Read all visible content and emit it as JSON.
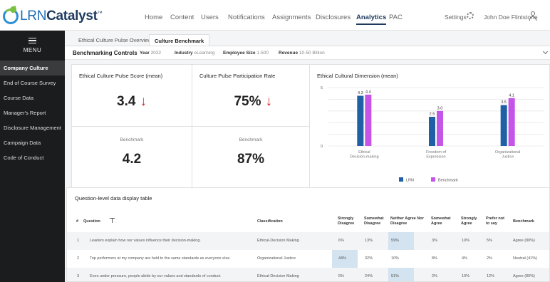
{
  "brand": {
    "prefix": "LRN",
    "suffix": "Catalyst",
    "tm": "™"
  },
  "topnav": {
    "items": [
      "Home",
      "Content",
      "Users",
      "Notifications",
      "Assignments",
      "Disclosures",
      "Analytics",
      "PAC"
    ],
    "active": "Analytics",
    "settings_label": "Settings",
    "user_name": "John Doe Flintstone"
  },
  "sidebar": {
    "menu_label": "MENU",
    "items": [
      "Company Culture",
      "End of Course Survey",
      "Course Data",
      "Manager's Report",
      "Disclosure Management",
      "Campaign Data",
      "Code of Conduct"
    ],
    "active": "Company Culture"
  },
  "tabs": [
    "Ethical Culture Pulse Overview",
    "Culture Benchmark"
  ],
  "active_tab": "Culture Benchmark",
  "controls": {
    "title": "Benchmarking Controls",
    "filters": [
      {
        "label": "Year",
        "value": "2022"
      },
      {
        "label": "Industry",
        "value": "eLearning"
      },
      {
        "label": "Employee Size",
        "value": "1-500"
      },
      {
        "label": "Revenue",
        "value": "10-50 Billion"
      }
    ]
  },
  "metrics": {
    "score": {
      "label": "Ethical Culture Pulse Score (mean)",
      "value": "3.4",
      "arrow": "↓",
      "bench_label": "Benchmark",
      "bench_value": "4.2"
    },
    "participation": {
      "label": "Culture Pulse Participation Rate",
      "value": "75%",
      "arrow": "↓",
      "bench_label": "Benchmark",
      "bench_value": "87%"
    }
  },
  "chart_data": {
    "type": "bar",
    "title": "Ethical Cultural Dimension (mean)",
    "categories": [
      [
        "Ethical",
        "Decision-making"
      ],
      [
        "Freedom of",
        "Expression"
      ],
      [
        "Organizational",
        "Justice"
      ]
    ],
    "series": [
      {
        "name": "LRN",
        "values": [
          4.3,
          2.5,
          3.5
        ],
        "color": "#1f5fa6"
      },
      {
        "name": "Benchmark",
        "values": [
          4.4,
          3.0,
          4.1
        ],
        "color": "#c455e8"
      }
    ],
    "ylim": [
      0,
      5
    ],
    "yticks": [
      0,
      5
    ],
    "grid": true,
    "legend": "bottom"
  },
  "table": {
    "title": "Question-level data display table",
    "headers": [
      "#",
      "Question",
      "Classification",
      "Strongly Disagree",
      "Somewhat Disagree",
      "Neither Agree Nor Disagree",
      "Somewhat Agree",
      "Strongly Agree",
      "Prefer not to say",
      "Benchmark"
    ],
    "rows": [
      {
        "num": "1",
        "question": "Leaders explain how our values influence their decision-making.",
        "classification": "Ethical-Decision Making",
        "values": [
          "6%",
          "13%",
          "59%",
          "3%",
          "10%",
          "5%"
        ],
        "benchmark": "Agree (80%)",
        "highlight": 2
      },
      {
        "num": "2",
        "question": "Top performers at my company are held to the same standards as everyone else.",
        "classification": "Organizational Justice",
        "values": [
          "44%",
          "32%",
          "10%",
          "8%",
          "4%",
          "2%"
        ],
        "benchmark": "Neutral (41%)",
        "highlight": 0
      },
      {
        "num": "3",
        "question": "Even under pressure, people abide by our values and standards of conduct.",
        "classification": "Ethical-Decision Making",
        "values": [
          "5%",
          "24%",
          "51%",
          "2%",
          "10%",
          "12%"
        ],
        "benchmark": "Agree (80%)",
        "highlight": 2
      }
    ]
  }
}
